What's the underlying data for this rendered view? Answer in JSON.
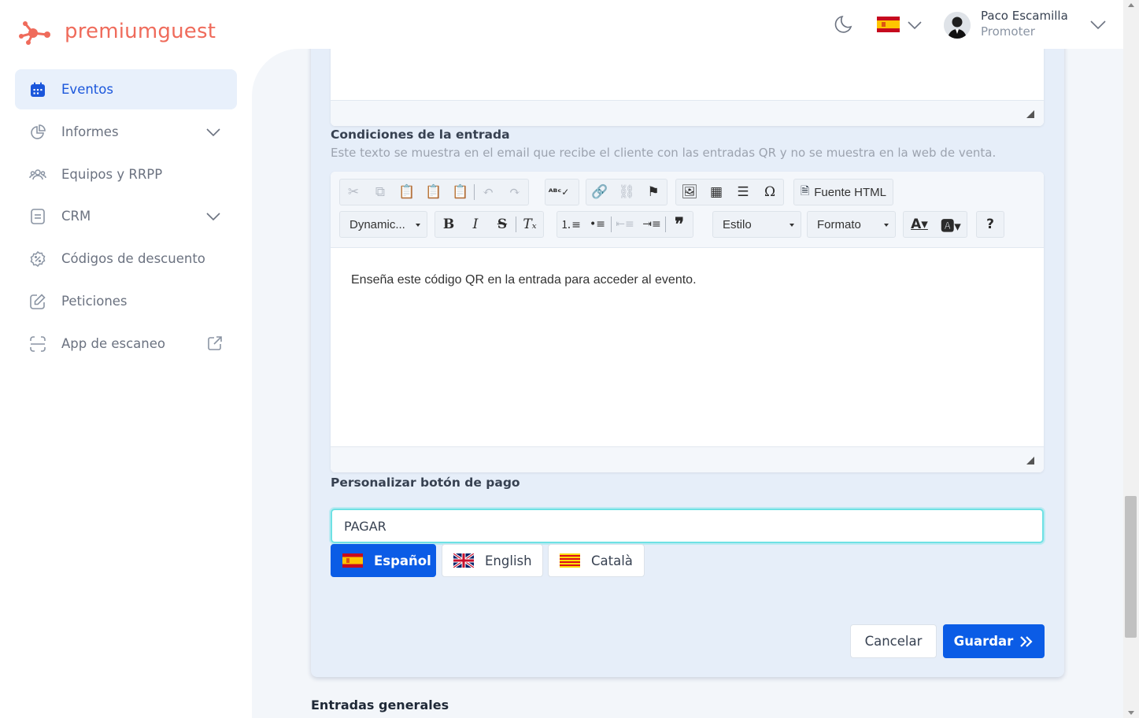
{
  "brand": {
    "name": "premiumguest",
    "color": "#ef6b5b"
  },
  "sidebar": {
    "items": [
      {
        "label": "Eventos",
        "icon": "calendar-icon",
        "active": true
      },
      {
        "label": "Informes",
        "icon": "pie-chart-icon",
        "expandable": true
      },
      {
        "label": "Equipos y RRPP",
        "icon": "users-icon"
      },
      {
        "label": "CRM",
        "icon": "document-icon",
        "expandable": true
      },
      {
        "label": "Códigos de descuento",
        "icon": "discount-badge-icon"
      },
      {
        "label": "Peticiones",
        "icon": "edit-icon"
      },
      {
        "label": "App de escaneo",
        "icon": "scan-icon",
        "external": true
      }
    ]
  },
  "header": {
    "theme_icon": "moon-icon",
    "language_flag": "spain-flag",
    "user": {
      "name": "Paco Escamilla",
      "role": "Promoter"
    }
  },
  "form": {
    "conditions": {
      "label": "Condiciones de la entrada",
      "help": "Este texto se muestra en el email que recibe el cliente con las entradas QR y no se muestra en la web de venta.",
      "content": "Enseña este código QR en la entrada para acceder al evento."
    },
    "toolbar": {
      "source_label": "Fuente HTML",
      "dynamic_label": "Dynamic...",
      "style_label": "Estilo",
      "format_label": "Formato"
    },
    "pay_button": {
      "label": "Personalizar botón de pago",
      "value": "PAGAR"
    },
    "languages": [
      {
        "label": "Español",
        "flag": "spain-flag",
        "active": true
      },
      {
        "label": "English",
        "flag": "uk-flag",
        "active": false
      },
      {
        "label": "Català",
        "flag": "catalonia-flag",
        "active": false
      }
    ],
    "actions": {
      "cancel": "Cancelar",
      "save": "Guardar"
    }
  },
  "next_section": {
    "title": "Entradas generales"
  },
  "colors": {
    "primary": "#0b5ce6",
    "focus": "#6ee1e4",
    "sidebar_active_bg": "#e8f0fb"
  }
}
